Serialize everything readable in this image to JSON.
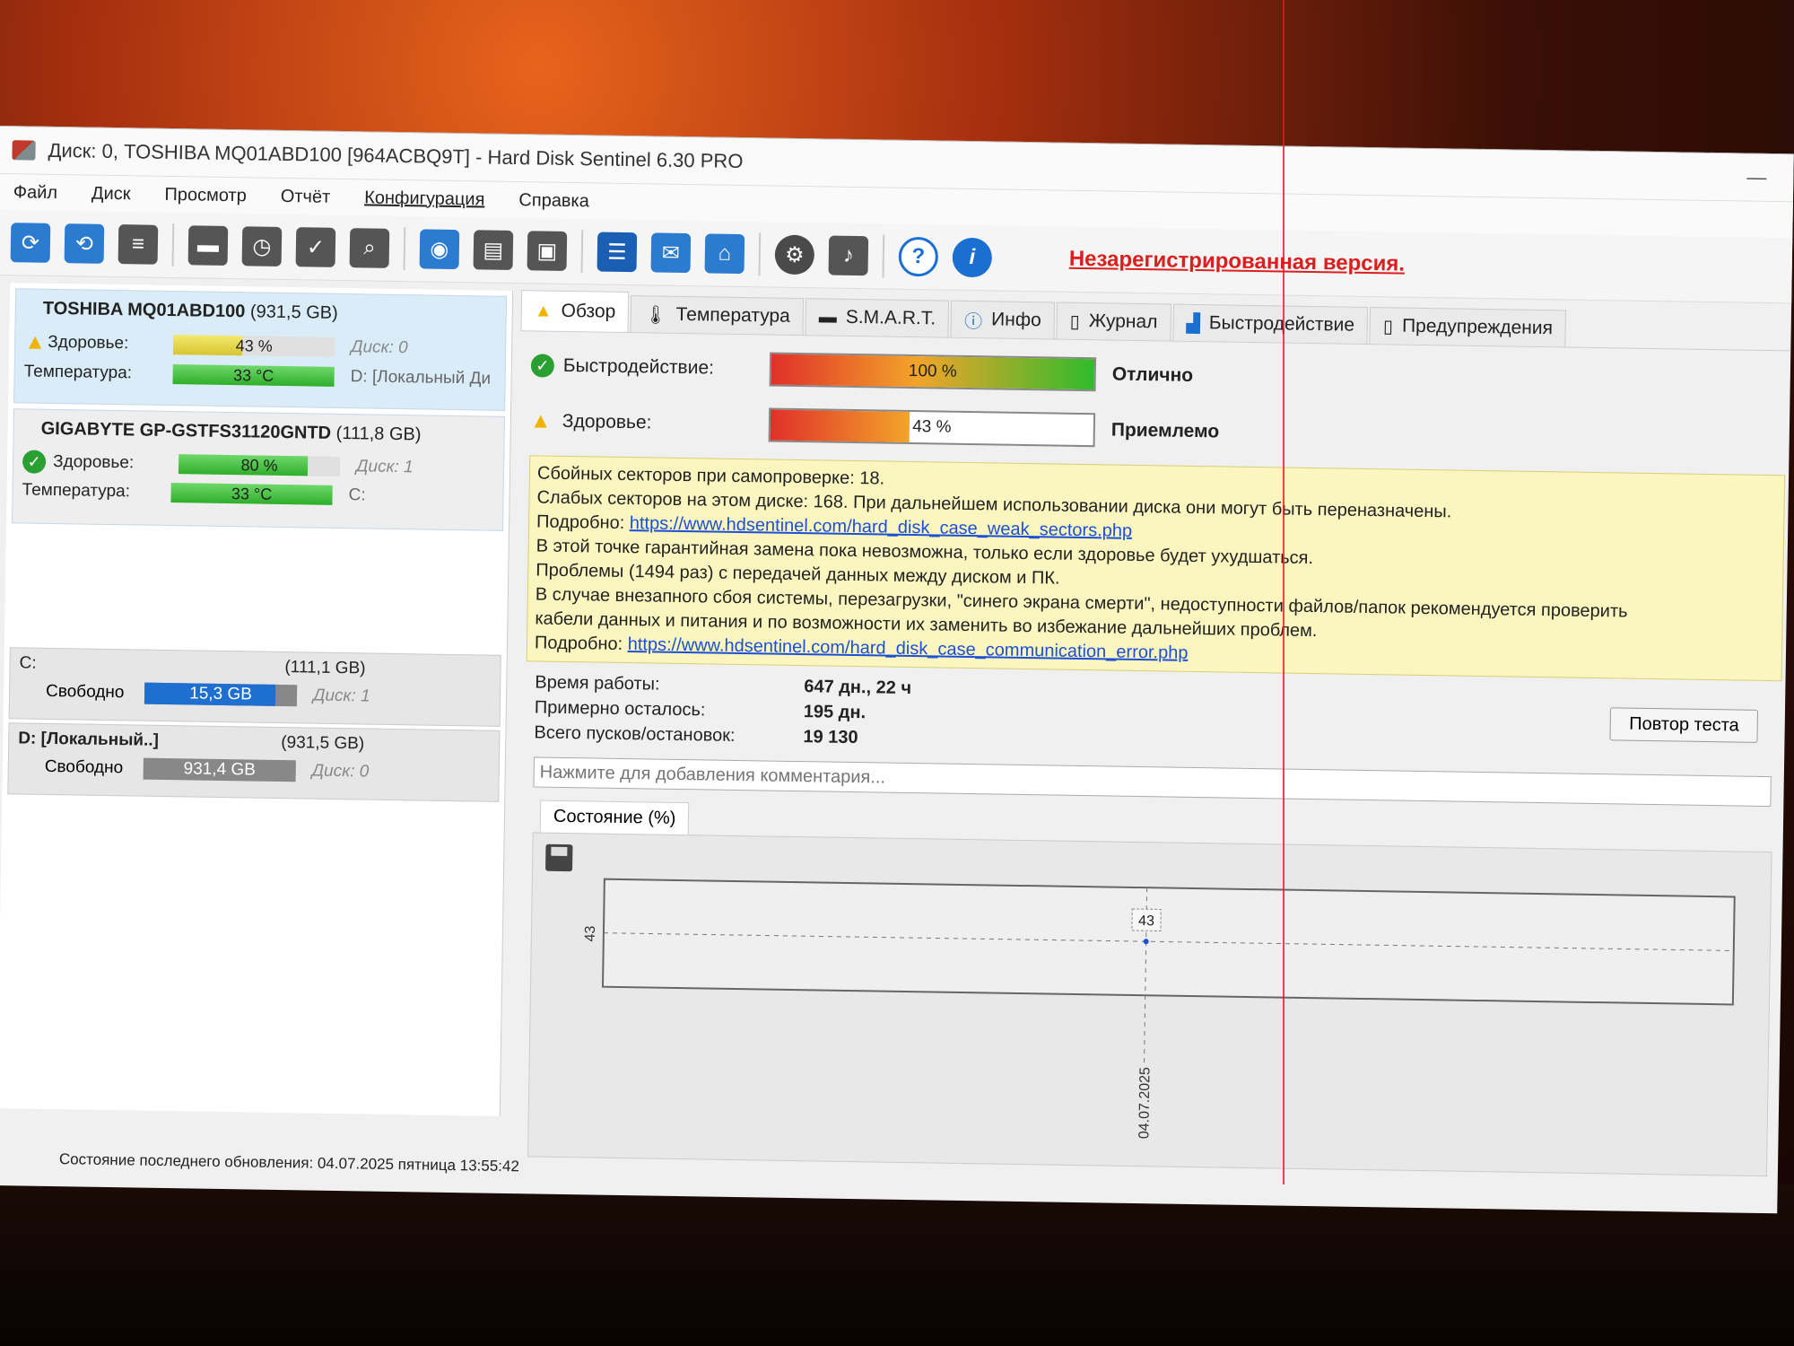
{
  "window": {
    "title": "Диск: 0, TOSHIBA MQ01ABD100 [964ACBQ9T]  -  Hard Disk Sentinel 6.30 PRO"
  },
  "menu": [
    "Файл",
    "Диск",
    "Просмотр",
    "Отчёт",
    "Конфигурация",
    "Справка"
  ],
  "toolbar": {
    "unregistered": "Незарегистрированная версия."
  },
  "disks": [
    {
      "name": "TOSHIBA MQ01ABD100",
      "capacity": "(931,5 GB)",
      "health_label": "Здоровье:",
      "health_value": "43 %",
      "health_pct": 43,
      "disk_label": "Диск: 0",
      "temp_label": "Температура:",
      "temp_value": "33 °C",
      "partition": "D: [Локальный Ди"
    },
    {
      "name": "GIGABYTE GP-GSTFS31120GNTD",
      "capacity": "(111,8 GB)",
      "health_label": "Здоровье:",
      "health_value": "80 %",
      "health_pct": 80,
      "disk_label": "Диск: 1",
      "temp_label": "Температура:",
      "temp_value": "33 °C",
      "partition": "C:"
    }
  ],
  "partitions": [
    {
      "name": "C:",
      "capacity": "(111,1 GB)",
      "free_label": "Свободно",
      "free_value": "15,3 GB",
      "free_pct": 14,
      "disk": "Диск: 1"
    },
    {
      "name": "D: [Локальный..]",
      "capacity": "(931,5 GB)",
      "free_label": "Свободно",
      "free_value": "931,4 GB",
      "free_pct": 0,
      "disk": "Диск: 0"
    }
  ],
  "status_bar": "Состояние последнего обновления: 04.07.2025 пятница 13:55:42",
  "tabs": [
    "Обзор",
    "Температура",
    "S.M.A.R.T.",
    "Инфо",
    "Журнал",
    "Быстродействие",
    "Предупреждения"
  ],
  "overview": {
    "performance": {
      "label": "Быстродействие:",
      "value": "100 %",
      "pct": 100,
      "rating": "Отлично"
    },
    "health": {
      "label": "Здоровье:",
      "value": "43 %",
      "pct": 43,
      "rating": "Приемлемо"
    },
    "messages": [
      "Сбойных секторов при самопроверке: 18.",
      "Слабых секторов на этом диске: 168. При дальнейшем использовании диска они могут быть переназначены.",
      "В этой точке гарантийная замена пока невозможна, только если здоровье будет ухудшаться.",
      "Проблемы (1494 раз) с передачей данных между диском и ПК.",
      "В случае внезапного сбоя системы, перезагрузки, \"синего экрана смерти\", недоступности файлов/папок рекомендуется проверить",
      "кабели данных и питания и по возможности их заменить во избежание дальнейших проблем."
    ],
    "detail_label": "Подробно:",
    "link1": "https://www.hdsentinel.com/hard_disk_case_weak_sectors.php",
    "link2": "https://www.hdsentinel.com/hard_disk_case_communication_error.php",
    "uptime_label": "Время работы:",
    "uptime_value": "647 дн., 22 ч",
    "remaining_label": "Примерно осталось:",
    "remaining_value": "195 дн.",
    "startstop_label": "Всего пусков/остановок:",
    "startstop_value": "19 130",
    "retest_button": "Повтор теста",
    "comment_placeholder": "Нажмите для добавления комментария...",
    "chart_tab": "Состояние (%)"
  },
  "chart_data": {
    "type": "line",
    "x": [
      "04.07.2025"
    ],
    "series": [
      {
        "values": [
          43
        ]
      }
    ],
    "ytick": "43",
    "point_label": "43"
  }
}
